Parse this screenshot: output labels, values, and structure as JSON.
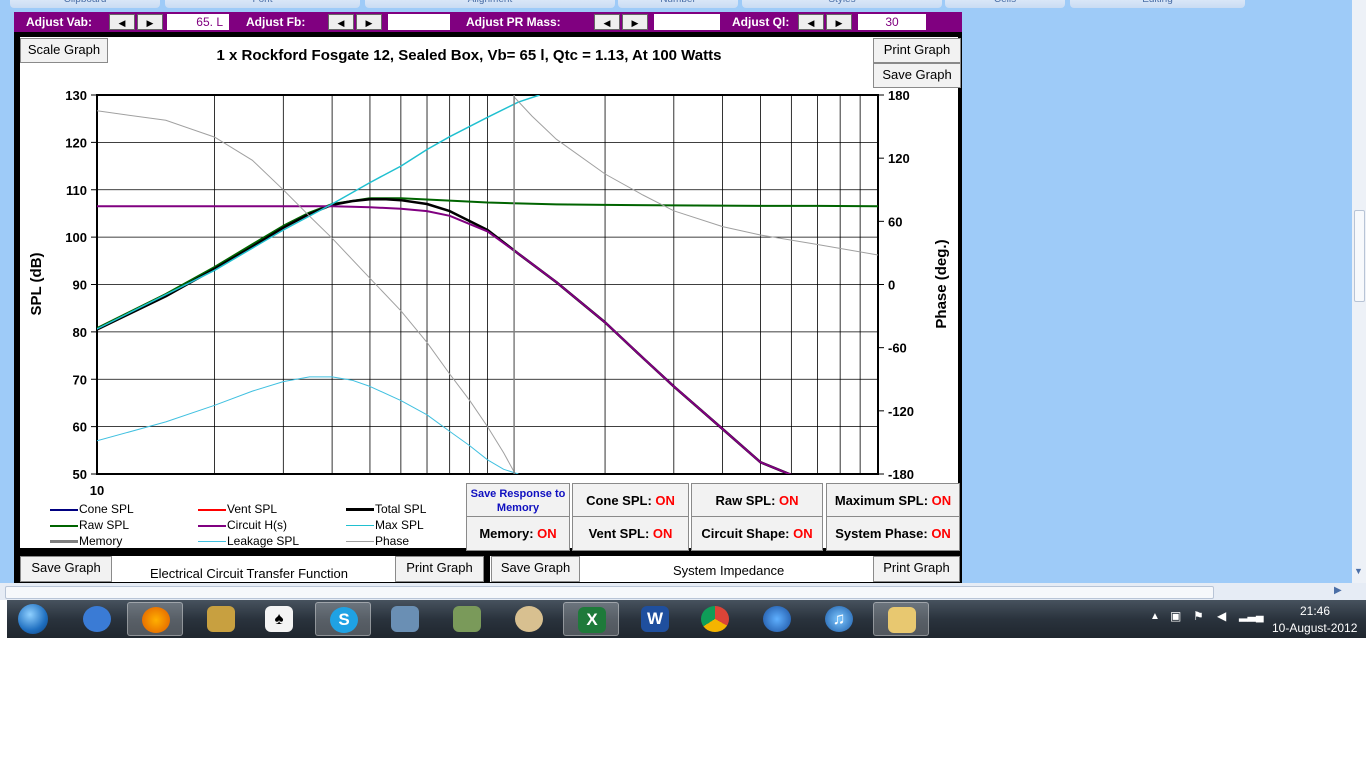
{
  "ribbon": {
    "groups": [
      "Clipboard",
      "Font",
      "Alignment",
      "Number",
      "Styles",
      "Cells",
      "Editing"
    ]
  },
  "controls": {
    "vab": {
      "label": "Adjust Vab:",
      "value": "65. L"
    },
    "fb": {
      "label": "Adjust Fb:",
      "value": ""
    },
    "pr_mass": {
      "label": "Adjust PR Mass:",
      "value": ""
    },
    "ql": {
      "label": "Adjust Ql:",
      "value": "30"
    },
    "spin_left": "◀",
    "spin_right": "▶"
  },
  "graph": {
    "scale_button": "Scale Graph",
    "print_button": "Print Graph",
    "save_button": "Save Graph"
  },
  "colors": {
    "cone": "#000080",
    "vent": "#ff0000",
    "total": "#000000",
    "raw": "#006400",
    "circuit": "#800080",
    "max": "#20c0d0",
    "memory": "#808080",
    "leakage": "#40c0e0",
    "phase": "#a0a0a0"
  },
  "chart_data": {
    "type": "line",
    "title": "1 x Rockford Fosgate 12,  Sealed Box, Vb= 65 l,  Qtc = 1.13,  At 100 Watts",
    "xlabel": "",
    "ylabel": "SPL (dB)",
    "y2label": "Phase (deg.)",
    "x_scale": "log",
    "xlim": [
      10,
      1000
    ],
    "ylim": [
      50,
      130
    ],
    "y2lim": [
      -180,
      180
    ],
    "x_tick_labels": [
      "10"
    ],
    "y_ticks": [
      50,
      60,
      70,
      80,
      90,
      100,
      110,
      120,
      130
    ],
    "y2_ticks": [
      -180,
      -120,
      -60,
      0,
      60,
      120,
      180
    ],
    "grid": true,
    "legend": {
      "placement": "bottom-left",
      "entries": [
        "Cone SPL",
        "Vent SPL",
        "Total SPL",
        "Raw SPL",
        "Circuit H(s)",
        "Max SPL",
        "Memory",
        "Leakage SPL",
        "Phase"
      ]
    },
    "series": [
      {
        "name": "Raw SPL",
        "axis": "left",
        "x": [
          10,
          15,
          20,
          25,
          30,
          35,
          40,
          50,
          60,
          80,
          100,
          150,
          200,
          300,
          500,
          700,
          1000
        ],
        "y": [
          80.8,
          88,
          93.7,
          98.5,
          102.4,
          105.2,
          107,
          108.2,
          108.2,
          107.7,
          107.3,
          106.9,
          106.8,
          106.7,
          106.6,
          106.6,
          106.5
        ]
      },
      {
        "name": "Total SPL",
        "axis": "left",
        "x": [
          10,
          15,
          20,
          25,
          30,
          35,
          40,
          45,
          50,
          55,
          60,
          70,
          80,
          100,
          120,
          150,
          200,
          250,
          300,
          400,
          500,
          600
        ],
        "y": [
          80.5,
          87.5,
          93.3,
          98,
          102,
          104.9,
          106.8,
          107.6,
          108,
          108,
          107.8,
          107,
          105.5,
          101.5,
          96.5,
          90.5,
          82,
          74.5,
          68.5,
          59.5,
          52.5,
          49.8
        ]
      },
      {
        "name": "Circuit H(s)",
        "axis": "left",
        "x": [
          10,
          15,
          20,
          25,
          30,
          35,
          40,
          45,
          50,
          60,
          70,
          80,
          100,
          120,
          150,
          200,
          250,
          300,
          400,
          500,
          600
        ],
        "y": [
          106.5,
          106.5,
          106.5,
          106.5,
          106.5,
          106.5,
          106.5,
          106.4,
          106.3,
          106,
          105.5,
          104.5,
          101.2,
          96.5,
          90.5,
          82,
          74.5,
          68.5,
          59.5,
          52.5,
          49.8
        ]
      },
      {
        "name": "Max SPL",
        "axis": "left",
        "x": [
          10,
          20,
          30,
          40,
          50,
          60,
          70,
          80,
          100,
          120,
          136
        ],
        "y": [
          80.6,
          93,
          101.5,
          107,
          111.5,
          115,
          118.5,
          121.2,
          125.3,
          128.5,
          130
        ]
      },
      {
        "name": "Leakage SPL",
        "axis": "left",
        "x": [
          10,
          15,
          20,
          25,
          30,
          35,
          40,
          45,
          50,
          60,
          70,
          80,
          90,
          100,
          110,
          120
        ],
        "y": [
          57,
          61,
          64.5,
          67.5,
          69.5,
          70.5,
          70.5,
          69.8,
          68.5,
          65.5,
          62.5,
          59,
          56,
          53,
          51,
          50
        ]
      },
      {
        "name": "Phase",
        "axis": "right",
        "x": [
          10,
          15,
          20,
          25,
          30,
          35,
          40,
          50,
          60,
          70,
          80,
          90,
          100,
          110,
          117,
          117.1,
          130,
          150,
          200,
          250,
          300,
          400,
          500,
          700,
          1000
        ],
        "y": [
          165,
          156,
          140,
          118,
          90,
          65,
          44,
          6,
          -25,
          -55,
          -85,
          -110,
          -135,
          -160,
          -178,
          178,
          160,
          138,
          105,
          85,
          70,
          55,
          47,
          38,
          28
        ]
      },
      {
        "name": "Memory",
        "axis": "right",
        "x": [
          117,
          117
        ],
        "y": [
          180,
          -180
        ]
      }
    ]
  },
  "legend_labels": {
    "cone": "Cone SPL",
    "vent": "Vent SPL",
    "total": "Total SPL",
    "raw": "Raw SPL",
    "circuit": "Circuit H(s)",
    "max": "Max SPL",
    "memory": "Memory",
    "leakage": "Leakage SPL",
    "phase": "Phase"
  },
  "status_buttons": {
    "save_response": "Save Response to Memory",
    "cone_spl": "Cone SPL:",
    "raw_spl": "Raw SPL:",
    "maximum_spl": "Maximum SPL:",
    "memory": "Memory:",
    "vent_spl": "Vent SPL:",
    "circuit_shape": "Circuit Shape:",
    "system_phase": "System Phase:",
    "on": "ON"
  },
  "bottom": {
    "save_graph_1": "Save Graph",
    "electrical_title": "Electrical Circuit Transfer Function",
    "print_graph_1": "Print Graph",
    "save_graph_2": "Save Graph",
    "impedance_title": "System Impedance",
    "print_graph_2": "Print Graph"
  },
  "taskbar": {
    "apps": [
      {
        "name": "start-orb",
        "label": ""
      },
      {
        "name": "thunderbird",
        "label": ""
      },
      {
        "name": "firefox",
        "label": ""
      },
      {
        "name": "solitaire-king",
        "label": ""
      },
      {
        "name": "solitaire",
        "label": ""
      },
      {
        "name": "skype",
        "label": "S"
      },
      {
        "name": "calculator",
        "label": ""
      },
      {
        "name": "camera",
        "label": ""
      },
      {
        "name": "paint",
        "label": ""
      },
      {
        "name": "excel",
        "label": "X"
      },
      {
        "name": "word",
        "label": "W"
      },
      {
        "name": "chrome",
        "label": ""
      },
      {
        "name": "google-earth",
        "label": ""
      },
      {
        "name": "itunes",
        "label": "♫"
      },
      {
        "name": "explorer",
        "label": ""
      }
    ],
    "time": "21:46",
    "date": "10-August-2012"
  }
}
